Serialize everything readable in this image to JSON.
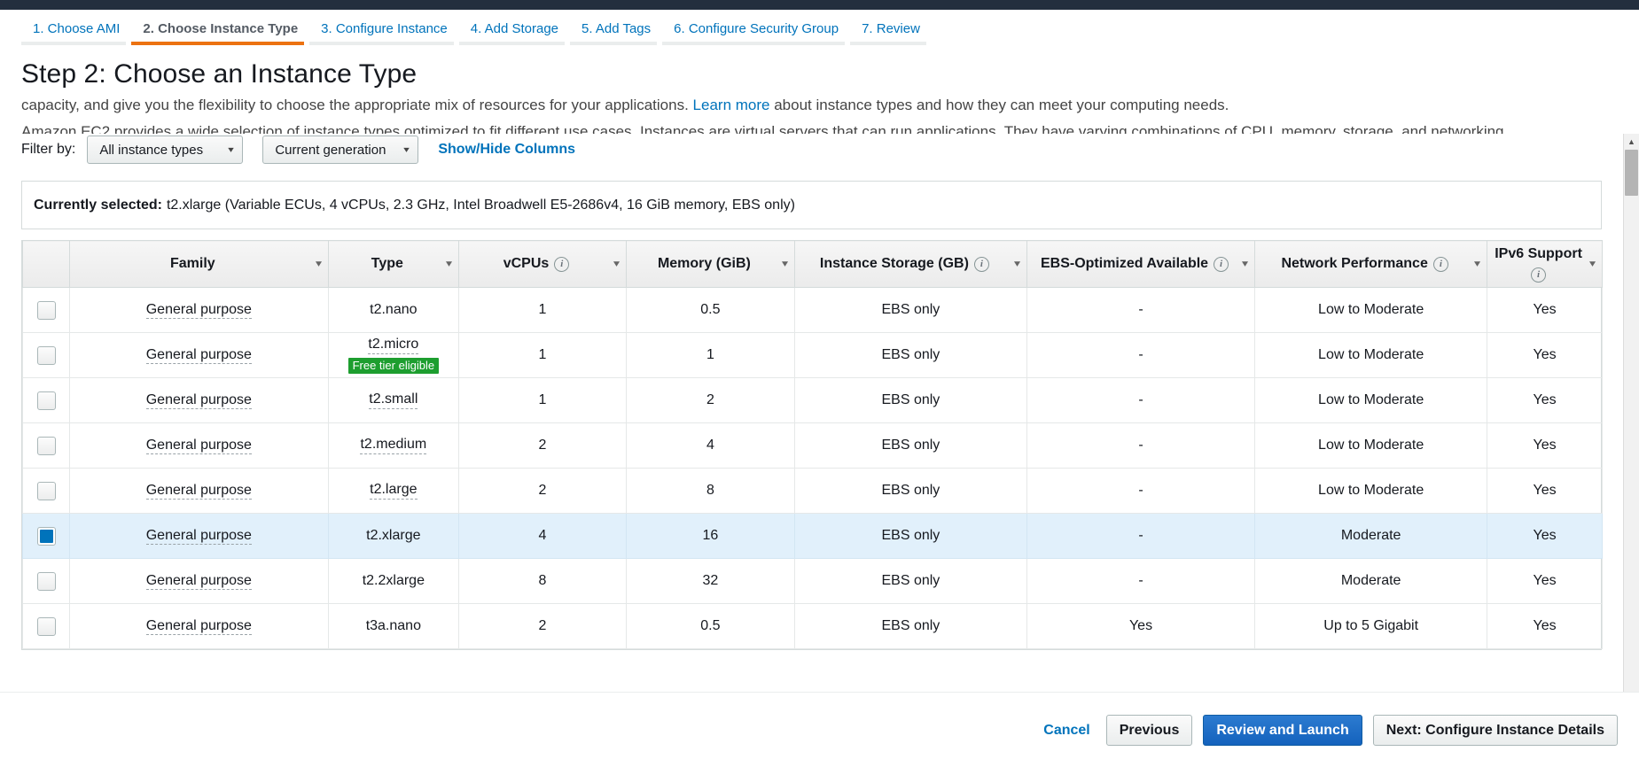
{
  "wizard": {
    "tabs": [
      {
        "label": "1. Choose AMI",
        "active": false
      },
      {
        "label": "2. Choose Instance Type",
        "active": true
      },
      {
        "label": "3. Configure Instance",
        "active": false
      },
      {
        "label": "4. Add Storage",
        "active": false
      },
      {
        "label": "5. Add Tags",
        "active": false
      },
      {
        "label": "6. Configure Security Group",
        "active": false
      },
      {
        "label": "7. Review",
        "active": false
      }
    ]
  },
  "page": {
    "title": "Step 2: Choose an Instance Type",
    "intro_prefix": "capacity, and give you the flexibility to choose the appropriate mix of resources for your applications.",
    "intro_link": "Learn more",
    "intro_suffix": "about instance types and how they can meet your computing needs."
  },
  "filter": {
    "label": "Filter by:",
    "instance_types_value": "All instance types",
    "generation_value": "Current generation",
    "show_hide_columns": "Show/Hide Columns",
    "caret": "▾"
  },
  "selected_banner": {
    "label": "Currently selected:",
    "value": "t2.xlarge (Variable ECUs, 4 vCPUs, 2.3 GHz, Intel Broadwell E5-2686v4, 16 GiB memory, EBS only)"
  },
  "table": {
    "columns": [
      {
        "key": "check",
        "label": "",
        "info": false
      },
      {
        "key": "family",
        "label": "Family",
        "info": false
      },
      {
        "key": "type",
        "label": "Type",
        "info": false
      },
      {
        "key": "vcpus",
        "label": "vCPUs",
        "info": true
      },
      {
        "key": "memory",
        "label": "Memory (GiB)",
        "info": false
      },
      {
        "key": "storage",
        "label": "Instance Storage (GB)",
        "info": true
      },
      {
        "key": "ebs",
        "label": "EBS-Optimized Available",
        "info": true
      },
      {
        "key": "network",
        "label": "Network Performance",
        "info": true
      },
      {
        "key": "ipv6",
        "label": "IPv6 Support",
        "info": true
      }
    ],
    "sort_caret": "▾",
    "info_glyph": "i",
    "free_tier_badge": "Free tier eligible",
    "rows": [
      {
        "selected": false,
        "family": "General purpose",
        "type": "t2.nano",
        "type_dotted": false,
        "free_tier": false,
        "vcpus": "1",
        "memory": "0.5",
        "storage": "EBS only",
        "ebs": "-",
        "network": "Low to Moderate",
        "ipv6": "Yes"
      },
      {
        "selected": false,
        "family": "General purpose",
        "type": "t2.micro",
        "type_dotted": true,
        "free_tier": true,
        "vcpus": "1",
        "memory": "1",
        "storage": "EBS only",
        "ebs": "-",
        "network": "Low to Moderate",
        "ipv6": "Yes"
      },
      {
        "selected": false,
        "family": "General purpose",
        "type": "t2.small",
        "type_dotted": true,
        "free_tier": false,
        "vcpus": "1",
        "memory": "2",
        "storage": "EBS only",
        "ebs": "-",
        "network": "Low to Moderate",
        "ipv6": "Yes"
      },
      {
        "selected": false,
        "family": "General purpose",
        "type": "t2.medium",
        "type_dotted": true,
        "free_tier": false,
        "vcpus": "2",
        "memory": "4",
        "storage": "EBS only",
        "ebs": "-",
        "network": "Low to Moderate",
        "ipv6": "Yes"
      },
      {
        "selected": false,
        "family": "General purpose",
        "type": "t2.large",
        "type_dotted": true,
        "free_tier": false,
        "vcpus": "2",
        "memory": "8",
        "storage": "EBS only",
        "ebs": "-",
        "network": "Low to Moderate",
        "ipv6": "Yes"
      },
      {
        "selected": true,
        "family": "General purpose",
        "type": "t2.xlarge",
        "type_dotted": false,
        "free_tier": false,
        "vcpus": "4",
        "memory": "16",
        "storage": "EBS only",
        "ebs": "-",
        "network": "Moderate",
        "ipv6": "Yes"
      },
      {
        "selected": false,
        "family": "General purpose",
        "type": "t2.2xlarge",
        "type_dotted": false,
        "free_tier": false,
        "vcpus": "8",
        "memory": "32",
        "storage": "EBS only",
        "ebs": "-",
        "network": "Moderate",
        "ipv6": "Yes"
      },
      {
        "selected": false,
        "family": "General purpose",
        "type": "t3a.nano",
        "type_dotted": false,
        "free_tier": false,
        "vcpus": "2",
        "memory": "0.5",
        "storage": "EBS only",
        "ebs": "Yes",
        "network": "Up to 5 Gigabit",
        "ipv6": "Yes"
      }
    ]
  },
  "scrollbar": {
    "up_arrow": "▲",
    "down_arrow": "▼"
  },
  "footer": {
    "cancel": "Cancel",
    "previous": "Previous",
    "review_and_launch": "Review and Launch",
    "next": "Next: Configure Instance Details"
  },
  "colors": {
    "accent_orange": "#ec7211",
    "link_blue": "#0073bb",
    "primary_button": "#1462bd",
    "free_tier_green": "#1d9e2f",
    "selected_row": "#e1f0fb",
    "topbar_navy": "#232f3e"
  }
}
